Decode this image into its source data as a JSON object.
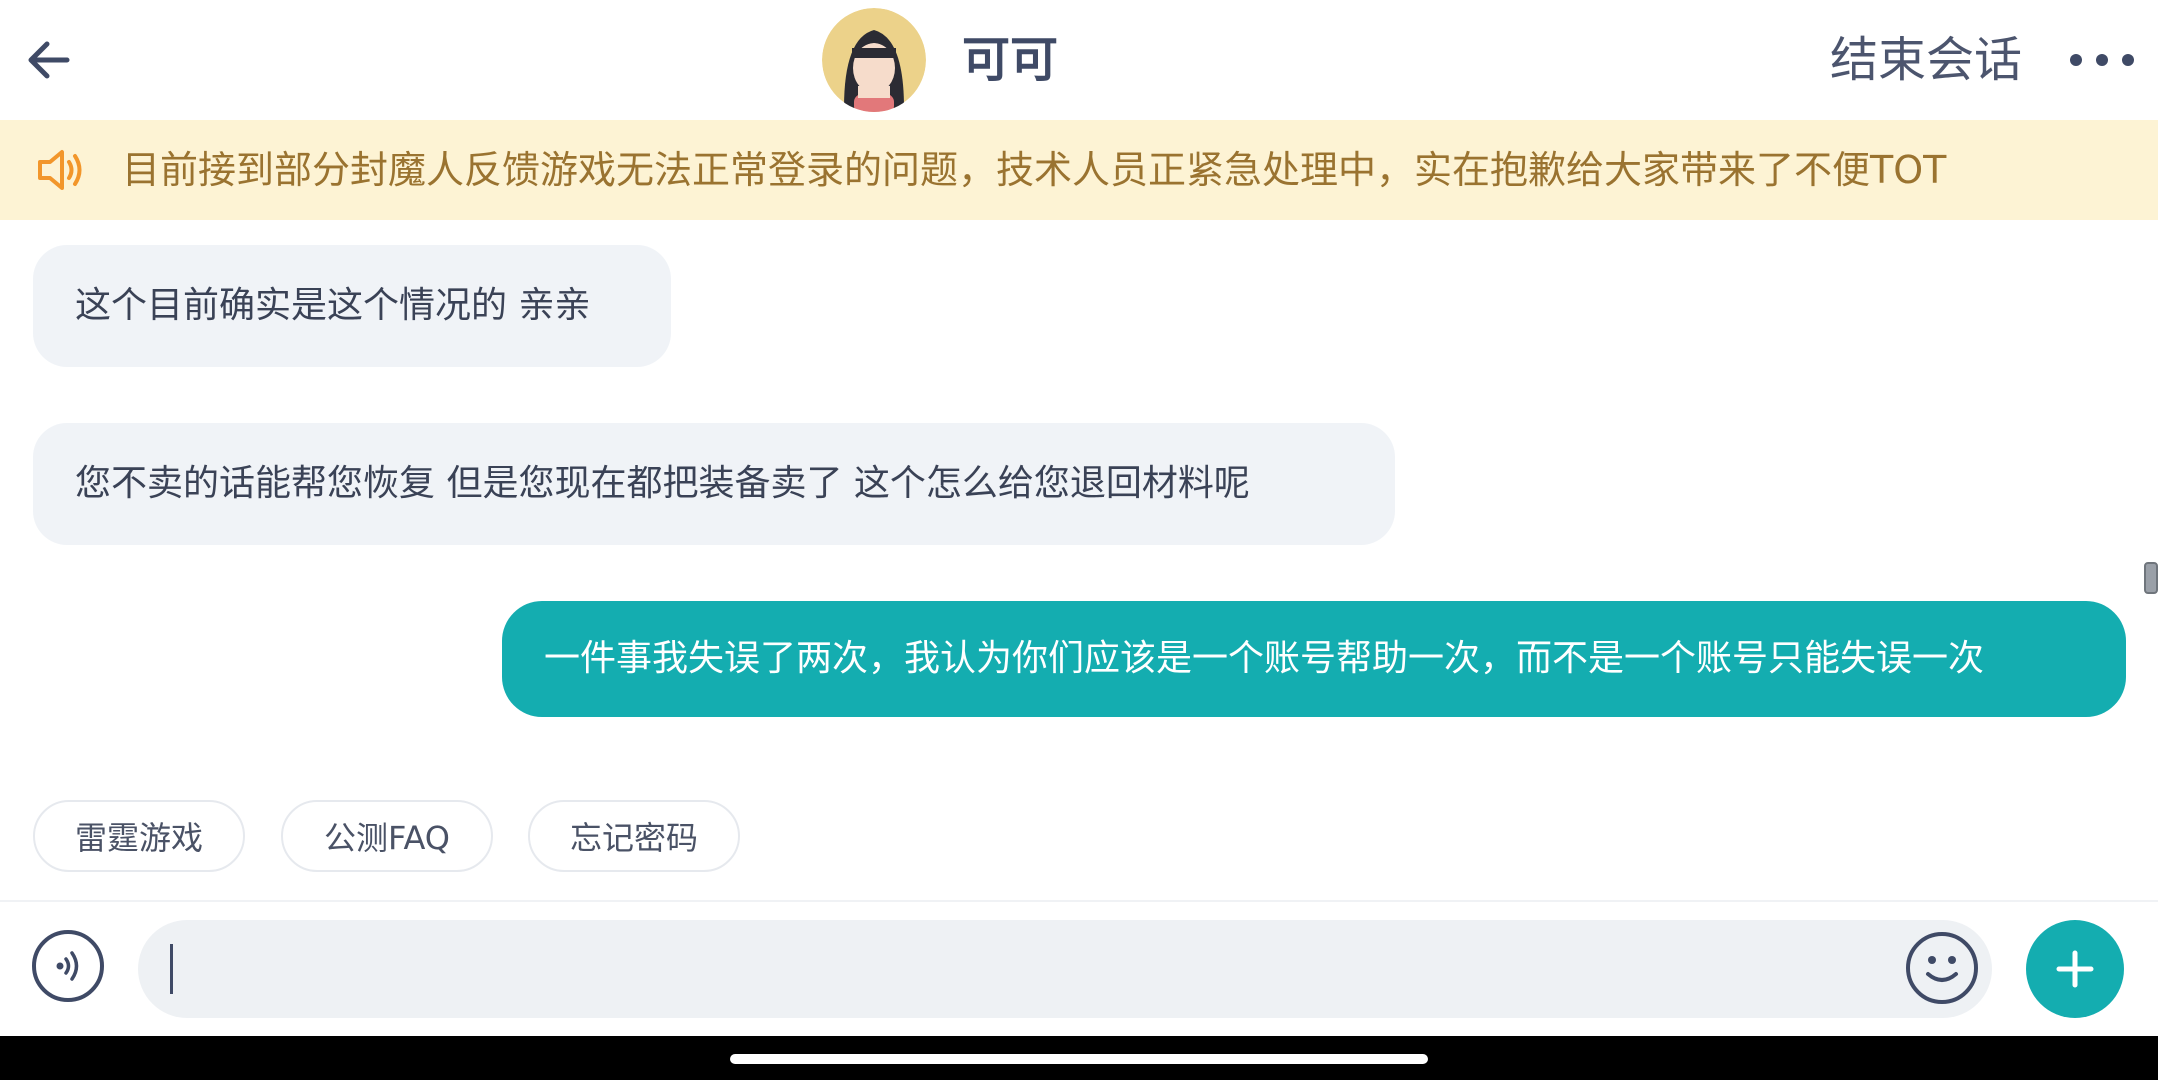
{
  "header": {
    "agent_name": "可可",
    "end_session_label": "结束会话",
    "back_icon": "back-arrow-icon",
    "more_icon": "more-dots-icon"
  },
  "notice": {
    "icon": "speaker-icon",
    "text": "目前接到部分封魔人反馈游戏无法正常登录的问题，技术人员正紧急处理中，实在抱歉给大家带来了不便TOT"
  },
  "messages": [
    {
      "from": "agent",
      "text": "这个目前确实是这个情况的 亲亲"
    },
    {
      "from": "agent",
      "text": "您不卖的话能帮您恢复 但是您现在都把装备卖了 这个怎么给您退回材料呢"
    },
    {
      "from": "user",
      "text": "一件事我失误了两次，我认为你们应该是一个账号帮助一次，而不是一个账号只能失误一次"
    }
  ],
  "quick_replies": [
    "雷霆游戏",
    "公测FAQ",
    "忘记密码"
  ],
  "input": {
    "value": "",
    "placeholder": ""
  },
  "colors": {
    "accent": "#14adb0",
    "notice_bg": "#fdf3d4",
    "notice_text": "#9a7330",
    "agent_bubble": "#f0f3f7",
    "text_dark": "#3f4a66"
  }
}
